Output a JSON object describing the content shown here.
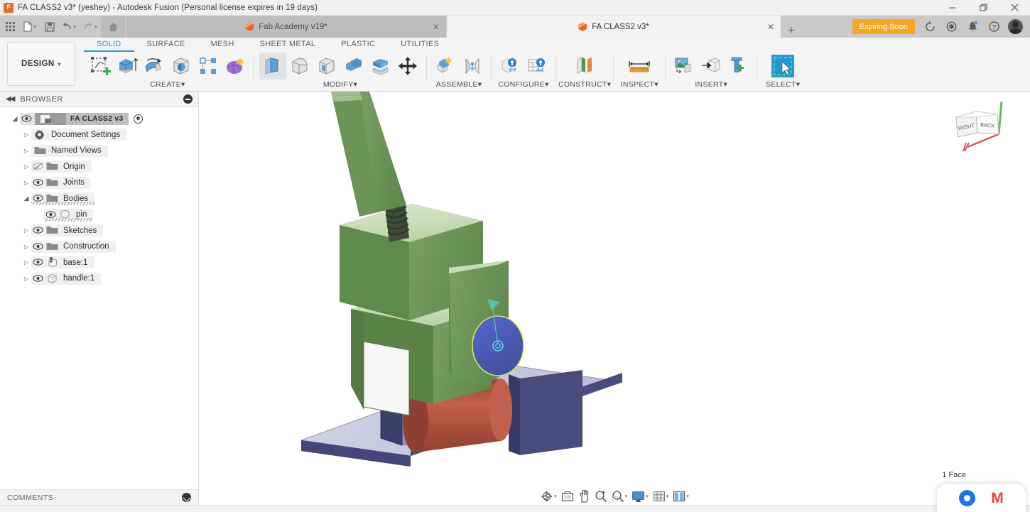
{
  "window": {
    "title": "FA CLASS2 v3* (yeshey) - Autodesk Fusion (Personal license expires in 19 days)",
    "minimize_label": "─",
    "restore_label": "❐",
    "close_label": "✕"
  },
  "quick_access": [
    {
      "name": "app-grid-icon",
      "label": ""
    },
    {
      "name": "new-file-icon",
      "label": ""
    },
    {
      "name": "save-icon",
      "label": ""
    },
    {
      "name": "undo-icon",
      "label": "↶"
    },
    {
      "name": "redo-icon",
      "label": "↷"
    },
    {
      "name": "home-icon",
      "label": ""
    }
  ],
  "tabs": [
    {
      "label": "Fab Academy v19*",
      "active": false,
      "close": "✕"
    },
    {
      "label": "FA CLASS2 v3*",
      "active": true,
      "close": "✕"
    }
  ],
  "tab_add_label": "+",
  "expiring_badge": "Expiring Soon",
  "system_icons": [
    "job-status-icon",
    "recent-icon",
    "notifications-icon",
    "help-icon",
    "account-avatar"
  ],
  "ribbon": {
    "design_label": "DESIGN",
    "design_caret": "▾",
    "workspace_tabs": [
      {
        "label": "SOLID",
        "active": true
      },
      {
        "label": "SURFACE",
        "active": false
      },
      {
        "label": "MESH",
        "active": false
      },
      {
        "label": "SHEET METAL",
        "active": false
      },
      {
        "label": "PLASTIC",
        "active": false
      },
      {
        "label": "UTILITIES",
        "active": false
      }
    ],
    "groups": [
      {
        "label": "CREATE",
        "caret": "▾",
        "tools": [
          "create-sketch-icon",
          "extrude-icon",
          "revolve-icon",
          "sphere-icon",
          "pattern-icon",
          "create-form-icon"
        ]
      },
      {
        "label": "MODIFY",
        "caret": "▾",
        "tools": [
          "press-pull-icon",
          "fillet-icon",
          "shell-icon",
          "combine-icon",
          "offset-face-icon",
          "move-copy-icon"
        ]
      },
      {
        "label": "ASSEMBLE",
        "caret": "▾",
        "tools": [
          "new-component-icon",
          "joint-icon"
        ]
      },
      {
        "label": "CONFIGURE",
        "caret": "▾",
        "tools": [
          "configure-design-icon",
          "configuration-table-icon"
        ]
      },
      {
        "label": "CONSTRUCT",
        "caret": "▾",
        "tools": [
          "offset-plane-icon"
        ]
      },
      {
        "label": "INSPECT",
        "caret": "▾",
        "tools": [
          "measure-icon"
        ]
      },
      {
        "label": "INSERT",
        "caret": "▾",
        "tools": [
          "insert-canvas-icon",
          "insert-derive-icon",
          "insert-mcmaster-icon"
        ]
      },
      {
        "label": "SELECT",
        "caret": "▾",
        "tools": [
          "select-window-icon"
        ]
      }
    ]
  },
  "browser": {
    "title": "BROWSER",
    "collapse_label": "◀◀",
    "tree": [
      {
        "label": "FA CLASS2 v3",
        "indent": 0,
        "twisty": "open",
        "eye": "visible",
        "icon": "document-icon",
        "root": true,
        "radio": true
      },
      {
        "label": "Document Settings",
        "indent": 1,
        "twisty": "closed",
        "eye": "none",
        "icon": "gear-icon"
      },
      {
        "label": "Named Views",
        "indent": 1,
        "twisty": "closed",
        "eye": "none",
        "icon": "folder-icon"
      },
      {
        "label": "Origin",
        "indent": 1,
        "twisty": "closed",
        "eye": "hidden",
        "icon": "folder-icon"
      },
      {
        "label": "Joints",
        "indent": 1,
        "twisty": "closed",
        "eye": "visible",
        "icon": "folder-icon"
      },
      {
        "label": "Bodies",
        "indent": 1,
        "twisty": "open",
        "eye": "visible",
        "icon": "bodies-folder-icon",
        "underline": true
      },
      {
        "label": "pin",
        "indent": 2,
        "twisty": "none",
        "eye": "visible",
        "icon": "body-icon",
        "underline": true
      },
      {
        "label": "Sketches",
        "indent": 1,
        "twisty": "closed",
        "eye": "visible",
        "icon": "folder-icon"
      },
      {
        "label": "Construction",
        "indent": 1,
        "twisty": "closed",
        "eye": "visible",
        "icon": "folder-icon"
      },
      {
        "label": "base:1",
        "indent": 1,
        "twisty": "closed",
        "eye": "visible",
        "icon": "grounded-component-icon"
      },
      {
        "label": "handle:1",
        "indent": 1,
        "twisty": "closed",
        "eye": "visible",
        "icon": "component-icon"
      }
    ]
  },
  "canvas": {
    "viewcube": {
      "face_right": "RIGHT",
      "face_back": "BACK"
    },
    "status_selection": "1 Face",
    "model": {
      "name": "toggle-clamp-assembly",
      "colors": {
        "handle_green": "#6d9557",
        "handle_green_light": "#cfe0bf",
        "handle_green_dark": "#4d7a3f",
        "base_blue": "#4a4a82",
        "base_blue_light": "#cfcfe4",
        "pin_red": "#b4503c",
        "selected_face": "#4d5fc4",
        "selection_outline": "#cfe05a",
        "annotation_cyan": "#33c9c9"
      }
    }
  },
  "comments": {
    "label": "COMMENTS",
    "toggle": "collapse-down-icon"
  },
  "navbar": [
    {
      "name": "orbit-icon",
      "caret": "▾"
    },
    {
      "name": "look-at-icon",
      "caret": ""
    },
    {
      "name": "pan-icon",
      "caret": ""
    },
    {
      "name": "zoom-icon",
      "caret": ""
    },
    {
      "name": "fit-icon",
      "caret": "▾"
    },
    {
      "name": "display-settings-icon",
      "caret": "▾"
    },
    {
      "name": "grid-snaps-icon",
      "caret": "▾"
    },
    {
      "name": "viewports-icon",
      "caret": "▾"
    }
  ],
  "taskbar_popup": {
    "chrome": "chrome-icon",
    "gmail": "gmail-icon"
  }
}
